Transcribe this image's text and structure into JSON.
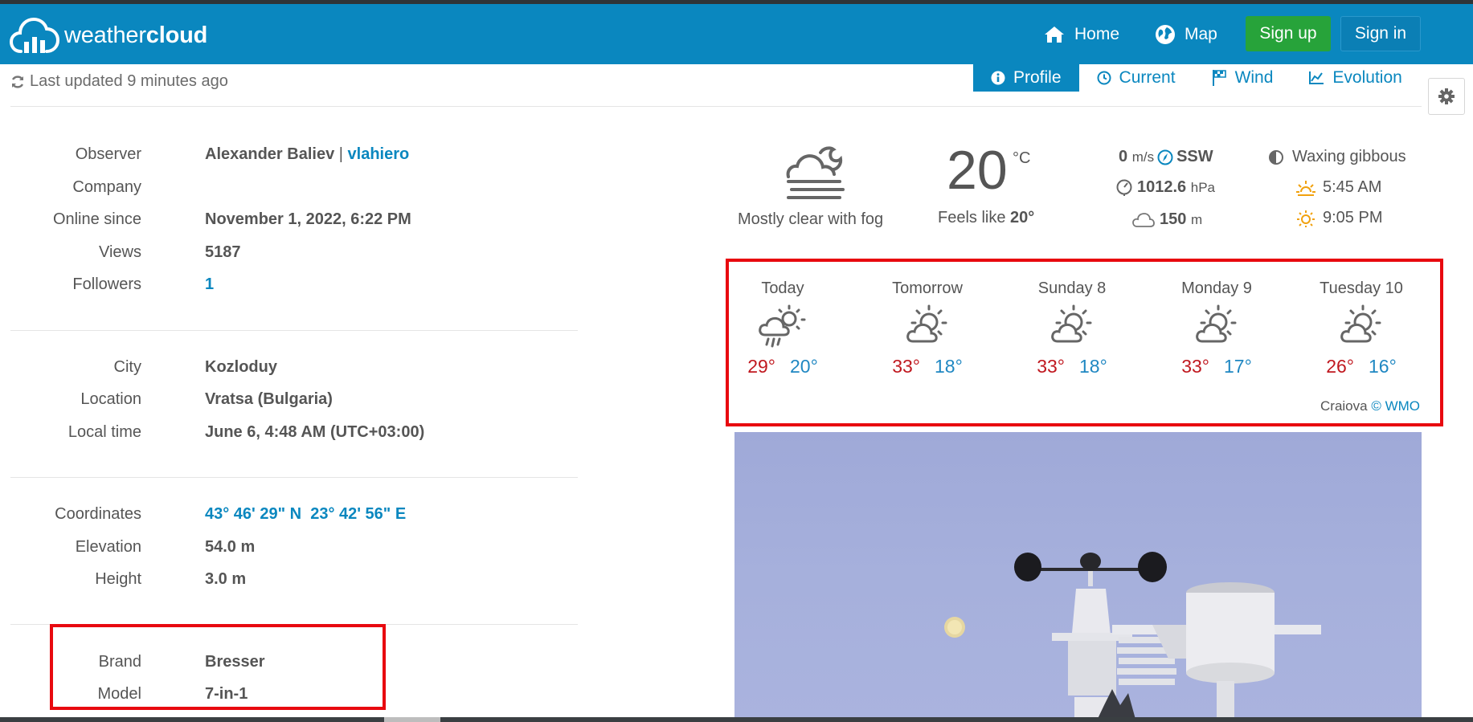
{
  "brand": {
    "name_light": "weather",
    "name_bold": "cloud"
  },
  "nav": {
    "home": "Home",
    "map": "Map",
    "signup": "Sign up",
    "signin": "Sign in"
  },
  "status": {
    "last_updated": "Last updated 9 minutes ago"
  },
  "tabs": [
    {
      "label": "Profile",
      "icon": "info-icon",
      "active": true
    },
    {
      "label": "Current",
      "icon": "clock-icon",
      "active": false
    },
    {
      "label": "Wind",
      "icon": "flag-icon",
      "active": false
    },
    {
      "label": "Evolution",
      "icon": "line-chart-icon",
      "active": false
    }
  ],
  "profile": {
    "observer_label": "Observer",
    "observer_name": "Alexander Baliev",
    "observer_sep": "|",
    "observer_user": "vlahiero",
    "company_label": "Company",
    "company": "",
    "online_label": "Online since",
    "online": "November 1, 2022, 6:22 PM",
    "views_label": "Views",
    "views": "5187",
    "followers_label": "Followers",
    "followers": "1",
    "city_label": "City",
    "city": "Kozloduy",
    "location_label": "Location",
    "location": "Vratsa (Bulgaria)",
    "localtime_label": "Local time",
    "localtime": "June 6, 4:48 AM (UTC+03:00)",
    "coords_label": "Coordinates",
    "coords": "43° 46' 29\" N  23° 42' 56\" E",
    "elevation_label": "Elevation",
    "elevation": "54.0 m",
    "height_label": "Height",
    "height": "3.0 m",
    "brand_label": "Brand",
    "brand": "Bresser",
    "model_label": "Model",
    "model": "7-in-1"
  },
  "current": {
    "condition": "Mostly clear with fog",
    "temp": "20",
    "temp_unit": "°C",
    "feels_label": "Feels like",
    "feels": "20°",
    "wind_speed": "0",
    "wind_unit": "m/s",
    "wind_dir": "SSW",
    "pressure": "1012.6",
    "pressure_unit": "hPa",
    "cloud_base": "150",
    "cloud_unit": "m",
    "moon_phase": "Waxing gibbous",
    "sunrise": "5:45 AM",
    "sunset": "9:05 PM"
  },
  "forecast": {
    "days": [
      {
        "name": "Today",
        "max": "29°",
        "min": "20°",
        "icon": "rain-cloud-sun-icon"
      },
      {
        "name": "Tomorrow",
        "max": "33°",
        "min": "18°",
        "icon": "partly-cloudy-icon"
      },
      {
        "name": "Sunday 8",
        "max": "33°",
        "min": "18°",
        "icon": "partly-cloudy-icon"
      },
      {
        "name": "Monday 9",
        "max": "33°",
        "min": "17°",
        "icon": "partly-cloudy-icon"
      },
      {
        "name": "Tuesday 10",
        "max": "26°",
        "min": "16°",
        "icon": "partly-cloudy-icon"
      }
    ],
    "source_city": "Craiova",
    "source_credit": "© WMO"
  },
  "colors": {
    "brand_blue": "#0a87bf",
    "signup_green": "#27a33a",
    "max_red": "#c0181f",
    "min_blue": "#1f87c2",
    "highlight": "#e8090f"
  }
}
